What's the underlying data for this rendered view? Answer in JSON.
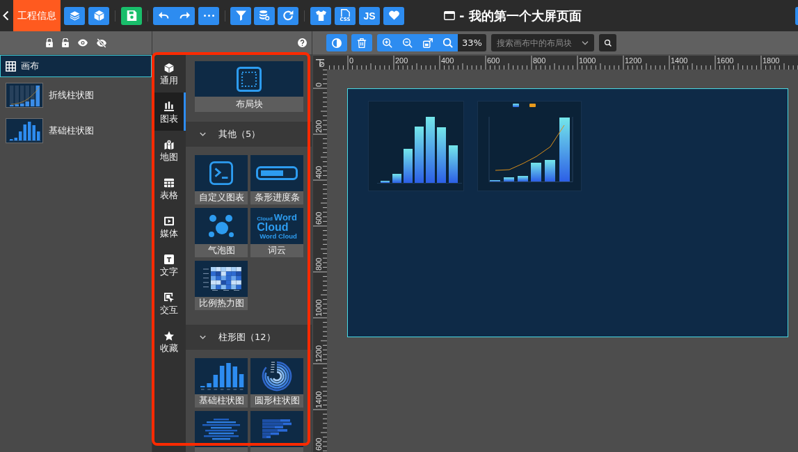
{
  "topbar": {
    "project_tab": "工程信息",
    "css_label": "CSS",
    "js_label": "JS",
    "title": "- 我的第一个大屏页面"
  },
  "layers": {
    "items": [
      {
        "kind": "canvas",
        "label": "画布",
        "selected": true
      },
      {
        "kind": "line-bar",
        "label": "折线柱状图",
        "selected": false
      },
      {
        "kind": "bar",
        "label": "基础柱状图",
        "selected": false
      }
    ]
  },
  "component_panel": {
    "highlighted": true,
    "categories": [
      {
        "label": "通用",
        "selected": false
      },
      {
        "label": "图表",
        "selected": true
      },
      {
        "label": "地图",
        "selected": false
      },
      {
        "label": "表格",
        "selected": false
      },
      {
        "label": "媒体",
        "selected": false
      },
      {
        "label": "文字",
        "selected": false
      },
      {
        "label": "交互",
        "selected": false
      },
      {
        "label": "收藏",
        "selected": false
      }
    ],
    "layout_block": {
      "label": "布局块"
    },
    "sections": [
      {
        "title": "其他（5）",
        "expanded": true,
        "word_cloud_preview": {
          "words": [
            "Cloud",
            "Word",
            "Cloud",
            "Word Cloud"
          ]
        },
        "items": [
          {
            "kind": "custom",
            "label": "自定义图表"
          },
          {
            "kind": "progress",
            "label": "条形进度条"
          },
          {
            "kind": "bubble",
            "label": "气泡图"
          },
          {
            "kind": "word-cloud",
            "label": "词云"
          },
          {
            "kind": "heatmap",
            "label": "比例热力图"
          }
        ]
      },
      {
        "title": "柱形图（12）",
        "expanded": true,
        "items": [
          {
            "kind": "bar",
            "label": "基础柱状图"
          },
          {
            "kind": "radial-bar",
            "label": "圆形柱状图"
          },
          {
            "kind": "centered-bar"
          },
          {
            "kind": "horizontal-bar"
          }
        ]
      }
    ]
  },
  "workspace": {
    "zoom": "33%",
    "search": {
      "placeholder": "搜索画布中的布局块"
    },
    "ruler": {
      "x_labels": [
        "0",
        "200",
        "400",
        "600",
        "800",
        "1000",
        "1200",
        "1400",
        "1600",
        "1800"
      ],
      "y_labels": [
        "0",
        "200",
        "400",
        "600",
        "800",
        "1000",
        "1200",
        "1400",
        "600"
      ]
    },
    "canvas": {
      "widgets": [
        {
          "kind": "bar"
        },
        {
          "kind": "line-bar"
        }
      ]
    }
  }
}
